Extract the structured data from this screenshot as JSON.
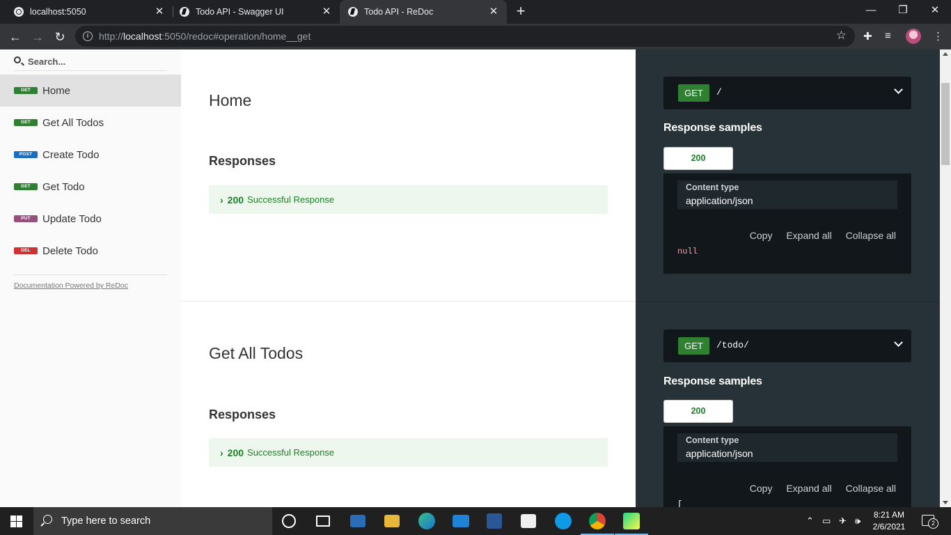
{
  "browser": {
    "tabs": [
      {
        "title": "localhost:5050",
        "active": false
      },
      {
        "title": "Todo API - Swagger UI",
        "active": false
      },
      {
        "title": "Todo API - ReDoc",
        "active": true
      }
    ],
    "url_prefix": "http://",
    "url_host": "localhost",
    "url_rest": ":5050/redoc#operation/home__get"
  },
  "sidebar": {
    "search_placeholder": "Search...",
    "items": [
      {
        "method": "GET",
        "label": "Home",
        "color": "#2f8132",
        "active": true
      },
      {
        "method": "GET",
        "label": "Get All Todos",
        "color": "#2f8132",
        "active": false
      },
      {
        "method": "POST",
        "label": "Create Todo",
        "color": "#186fbf",
        "active": false
      },
      {
        "method": "GET",
        "label": "Get Todo",
        "color": "#2f8132",
        "active": false
      },
      {
        "method": "PUT",
        "label": "Update Todo",
        "color": "#95507c",
        "active": false
      },
      {
        "method": "DEL",
        "label": "Delete Todo",
        "color": "#cc3333",
        "active": false
      }
    ],
    "powered_by": "Documentation Powered by ReDoc"
  },
  "operations": [
    {
      "title": "Home",
      "responses_heading": "Responses",
      "response_code": "200",
      "response_text": "Successful Response",
      "method": "GET",
      "path": "/",
      "samples_heading": "Response samples",
      "sample_status": "200",
      "content_type_label": "Content type",
      "content_type": "application/json",
      "actions": [
        "Copy",
        "Expand all",
        "Collapse all"
      ],
      "sample_body": "null"
    },
    {
      "title": "Get All Todos",
      "responses_heading": "Responses",
      "response_code": "200",
      "response_text": "Successful Response",
      "method": "GET",
      "path": "/todo/",
      "samples_heading": "Response samples",
      "sample_status": "200",
      "content_type_label": "Content type",
      "content_type": "application/json",
      "actions": [
        "Copy",
        "Expand all",
        "Collapse all"
      ],
      "sample_body": "["
    }
  ],
  "taskbar": {
    "search_text": "Type here to search",
    "time": "8:21 AM",
    "date": "2/6/2021",
    "notifications": "2"
  },
  "colors": {
    "get_green": "#2f8132",
    "right_panel": "#263238",
    "accent_blue": "#76b9ed"
  }
}
